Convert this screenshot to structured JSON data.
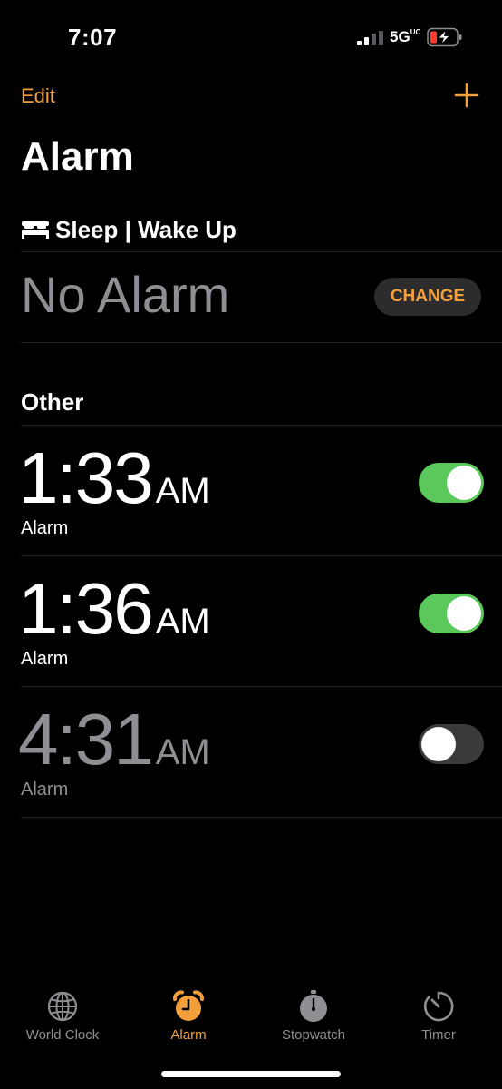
{
  "status_bar": {
    "time": "7:07",
    "network": "5G",
    "network_badge": "UC"
  },
  "header": {
    "edit_label": "Edit",
    "add_icon": "plus-icon",
    "title": "Alarm"
  },
  "sleep": {
    "icon": "bed-icon",
    "title": "Sleep | Wake Up",
    "status_text": "No Alarm",
    "change_label": "CHANGE"
  },
  "other": {
    "title": "Other",
    "alarms": [
      {
        "time": "1:33",
        "ampm": "AM",
        "label": "Alarm",
        "enabled": true
      },
      {
        "time": "1:36",
        "ampm": "AM",
        "label": "Alarm",
        "enabled": true
      },
      {
        "time": "4:31",
        "ampm": "AM",
        "label": "Alarm",
        "enabled": false
      }
    ]
  },
  "tabs": [
    {
      "label": "World Clock",
      "icon": "globe-icon",
      "active": false
    },
    {
      "label": "Alarm",
      "icon": "alarm-clock-icon",
      "active": true
    },
    {
      "label": "Stopwatch",
      "icon": "stopwatch-icon",
      "active": false
    },
    {
      "label": "Timer",
      "icon": "timer-icon",
      "active": false
    }
  ],
  "colors": {
    "accent": "#f3a03c",
    "toggle_on": "#5ac85a",
    "toggle_off": "#3a3a3c",
    "secondary_text": "#8e8e93",
    "background": "#000000",
    "battery_low": "#ff3b30"
  }
}
